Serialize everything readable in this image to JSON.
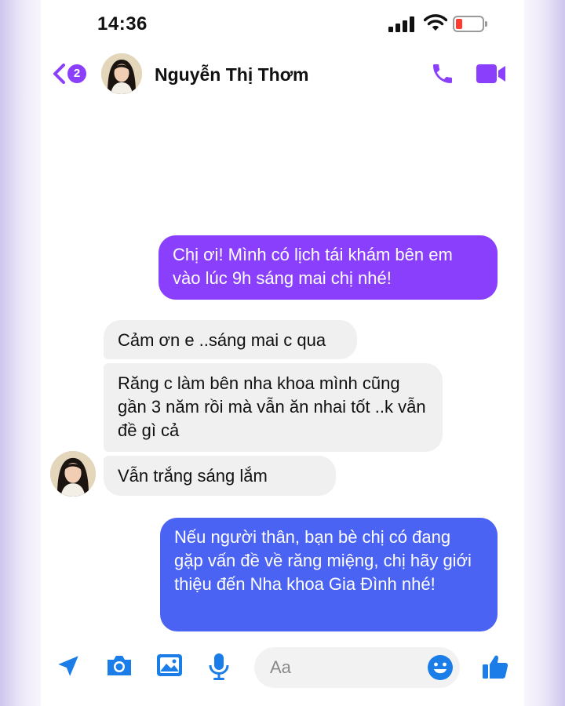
{
  "status_bar": {
    "time": "14:36",
    "battery_color": "#ff3b30"
  },
  "header": {
    "back_count": "2",
    "contact_name": "Nguyễn Thị Thơm",
    "accent_color": "#8a3ffc",
    "icons": [
      "chevron-left-icon",
      "avatar",
      "phone-icon",
      "video-camera-icon"
    ]
  },
  "messages": [
    {
      "direction": "outgoing",
      "text": "Chị ơi! Mình có lịch tái khám bên em vào lúc 9h sáng mai chị nhé!",
      "color": "#8a3ffc"
    },
    {
      "direction": "incoming",
      "text": "Cảm ơn e ..sáng mai c qua",
      "color": "#f0f0f0"
    },
    {
      "direction": "incoming",
      "text": "Răng c làm bên nha khoa mình cũng gần 3 năm rồi mà vẫn ăn nhai tốt ..k vẫn đề gì cả",
      "color": "#f0f0f0"
    },
    {
      "direction": "incoming",
      "text": "Vẫn trắng sáng lắm",
      "color": "#f0f0f0"
    },
    {
      "direction": "outgoing",
      "text": "Nếu người thân, bạn bè chị có đang gặp vấn đề về răng miệng, chị hãy giới thiệu đến Nha khoa Gia Đình nhé!",
      "color": "#4b63f2"
    }
  ],
  "composer": {
    "placeholder": "Aa",
    "icon_color": "#1a7de8",
    "icons": [
      "send-location-icon",
      "camera-icon",
      "image-icon",
      "microphone-icon",
      "emoji-icon",
      "thumbs-up-icon"
    ]
  }
}
